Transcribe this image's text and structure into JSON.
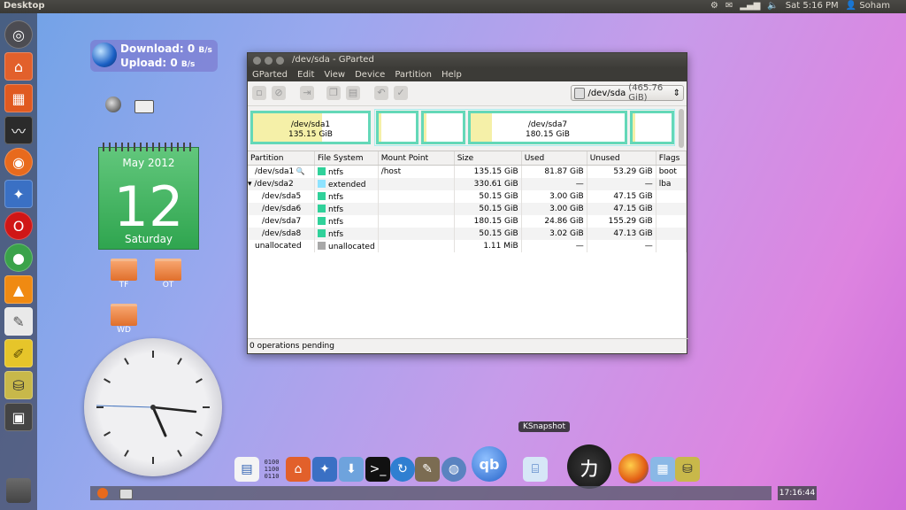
{
  "top_panel": {
    "title": "Desktop",
    "date_time": "Sat  5:16 PM",
    "user": "Soham"
  },
  "network_widget": {
    "download_label": "Download: 0",
    "download_unit": "B/s",
    "upload_label": "Upload: 0",
    "upload_unit": "B/s"
  },
  "calendar": {
    "month": "May 2012",
    "day": "12",
    "weekday": "Saturday"
  },
  "folders": [
    "TF",
    "OT",
    "WD"
  ],
  "gparted": {
    "title": "/dev/sda - GParted",
    "menu": [
      "GParted",
      "Edit",
      "View",
      "Device",
      "Partition",
      "Help"
    ],
    "device": "/dev/sda",
    "device_size": "(465.76 GiB)",
    "map": [
      {
        "name": "/dev/sda1",
        "size": "135.15 GiB"
      },
      {
        "name": "/dev/sda7",
        "size": "180.15 GiB"
      }
    ],
    "columns": [
      "Partition",
      "File System",
      "Mount Point",
      "Size",
      "Used",
      "Unused",
      "Flags"
    ],
    "rows": [
      {
        "partition": "/dev/sda1",
        "fs": "ntfs",
        "mount": "/host",
        "size": "135.15 GiB",
        "used": "81.87 GiB",
        "unused": "53.29 GiB",
        "flags": "boot",
        "color": "#30d19a"
      },
      {
        "partition": "/dev/sda2",
        "fs": "extended",
        "mount": "",
        "size": "330.61 GiB",
        "used": "—",
        "unused": "—",
        "flags": "lba",
        "color": "#8ee3ff"
      },
      {
        "partition": "/dev/sda5",
        "fs": "ntfs",
        "mount": "",
        "size": "50.15 GiB",
        "used": "3.00 GiB",
        "unused": "47.15 GiB",
        "flags": "",
        "color": "#30d19a"
      },
      {
        "partition": "/dev/sda6",
        "fs": "ntfs",
        "mount": "",
        "size": "50.15 GiB",
        "used": "3.00 GiB",
        "unused": "47.15 GiB",
        "flags": "",
        "color": "#30d19a"
      },
      {
        "partition": "/dev/sda7",
        "fs": "ntfs",
        "mount": "",
        "size": "180.15 GiB",
        "used": "24.86 GiB",
        "unused": "155.29 GiB",
        "flags": "",
        "color": "#30d19a"
      },
      {
        "partition": "/dev/sda8",
        "fs": "ntfs",
        "mount": "",
        "size": "50.15 GiB",
        "used": "3.02 GiB",
        "unused": "47.13 GiB",
        "flags": "",
        "color": "#30d19a"
      },
      {
        "partition": "unallocated",
        "fs": "unallocated",
        "mount": "",
        "size": "1.11 MiB",
        "used": "—",
        "unused": "—",
        "flags": "",
        "color": "#a8a8a8"
      }
    ],
    "status": "0 operations pending"
  },
  "dock": {
    "tooltip": "KSnapshot",
    "binary_text": "0100\n1100\n0110"
  },
  "bottom_clock": "17:16:44",
  "colors": {
    "partition_border": "#64d8b8",
    "used_fill": "#f5f0a8"
  }
}
